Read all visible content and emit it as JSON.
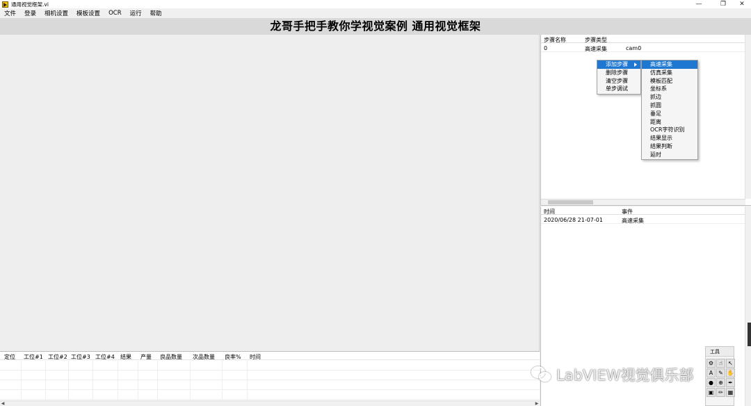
{
  "window": {
    "title": "通用视觉框架.vi",
    "controls": {
      "minimize": "—",
      "restore": "❐",
      "close": "✕"
    }
  },
  "menubar": {
    "items": [
      "文件",
      "登录",
      "相机设置",
      "模板设置",
      "OCR",
      "运行",
      "帮助"
    ]
  },
  "page_title": "龙哥手把手教你学视觉案例 通用视觉框架",
  "bottom_table": {
    "headers": [
      "定位",
      "工位#1",
      "工位#2",
      "工位#3",
      "工位#4",
      "结果",
      "产量",
      "良品数量",
      "次品数量",
      "良率%",
      "时间"
    ]
  },
  "step_table": {
    "headers": [
      "步骤名称",
      "步骤类型"
    ],
    "rows": [
      {
        "name": "0",
        "type": "高速采集",
        "param": "cam0"
      }
    ]
  },
  "context_menu": {
    "items": [
      "添加步骤",
      "删除步骤",
      "清空步骤",
      "单步调试"
    ],
    "highlighted_index": 0
  },
  "submenu": {
    "items": [
      "高速采集",
      "仿真采集",
      "模板匹配",
      "坐标系",
      "抓边",
      "抓圆",
      "垂足",
      "距离",
      "OCR字符识别",
      "结果显示",
      "结果判断",
      "延时"
    ],
    "highlighted_index": 0
  },
  "event_table": {
    "headers": [
      "时间",
      "事件"
    ],
    "rows": [
      {
        "time": "2020/06/28 21-07-01",
        "event": "高速采集"
      }
    ]
  },
  "tools_palette": {
    "title": "工具"
  },
  "watermark": {
    "text": "LabVIEW视觉俱乐部"
  },
  "colors": {
    "highlight": "#1e78d2",
    "title_band": "#d9d9d9",
    "panel_bg": "#eeeeee"
  }
}
